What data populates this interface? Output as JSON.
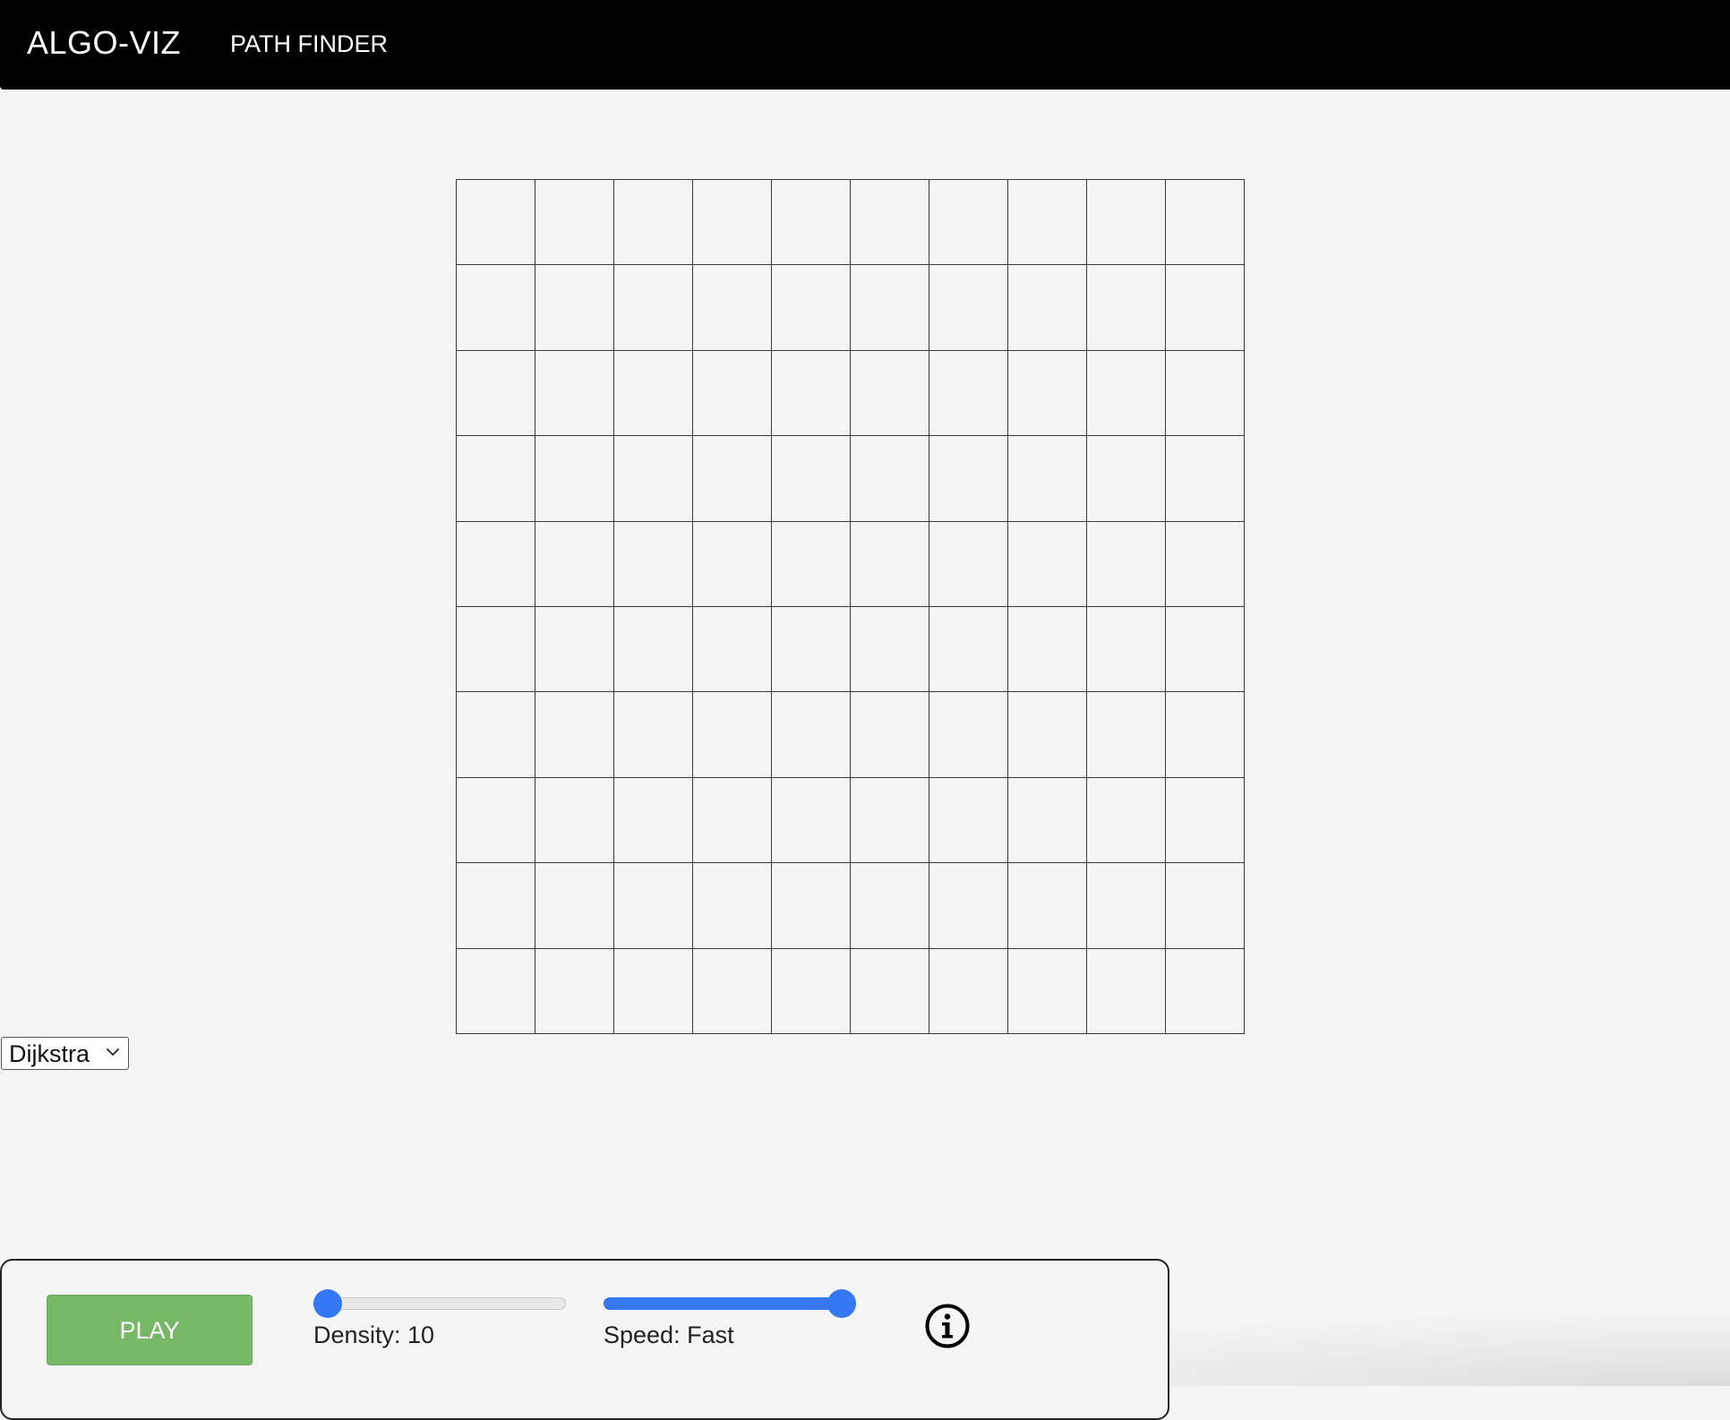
{
  "navbar": {
    "brand": "ALGO-VIZ",
    "link": "PATH FINDER"
  },
  "grid": {
    "rows": 10,
    "cols": 10
  },
  "algorithm": {
    "selected": "Dijkstra"
  },
  "controls": {
    "play_label": "PLAY",
    "density": {
      "label": "Density: 10",
      "value_fraction": 0.0
    },
    "speed": {
      "label": "Speed: Fast",
      "value_fraction": 1.0
    }
  },
  "colors": {
    "navbar": "#000000",
    "background": "#f5f5f5",
    "play_button": "#76b866",
    "slider_accent": "#3478f6",
    "grid_line": "#3a3a3a"
  },
  "icons": {
    "info": "info-circle-icon",
    "select_chevron": "chevron-down-icon"
  }
}
